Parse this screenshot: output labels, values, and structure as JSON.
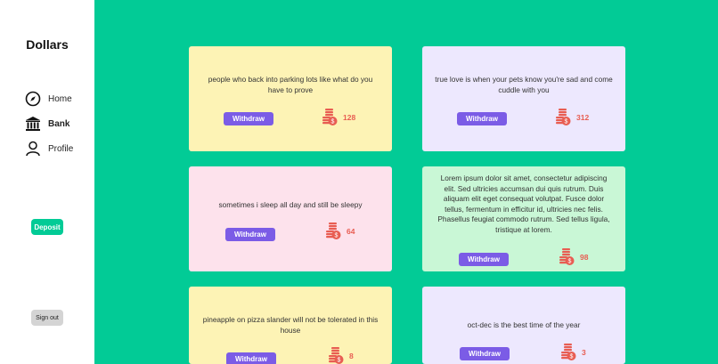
{
  "app": {
    "title": "Dollars"
  },
  "nav": [
    {
      "label": "Home",
      "icon": "compass-icon"
    },
    {
      "label": "Bank",
      "icon": "bank-icon",
      "active": true
    },
    {
      "label": "Profile",
      "icon": "user-icon"
    }
  ],
  "actions": {
    "deposit_label": "Deposit",
    "signout_label": "Sign out"
  },
  "cards": [
    {
      "text": "people who back into parking lots like what do you have to prove",
      "button": "Withdraw",
      "count": "128",
      "color": "#fdf3b5"
    },
    {
      "text": "true love is when your pets know you're sad and come cuddle with you",
      "button": "Withdraw",
      "count": "312",
      "color": "#ede8fe"
    },
    {
      "text": "sometimes i sleep all day and still be sleepy",
      "button": "Withdraw",
      "count": "64",
      "color": "#fde2ec"
    },
    {
      "text": "Lorem ipsum dolor sit amet, consectetur adipiscing elit. Sed ultricies accumsan dui quis rutrum. Duis aliquam elit eget consequat volutpat. Fusce dolor tellus, fermentum in efficitur id, ultricies nec felis. Phasellus feugiat commodo rutrum. Sed tellus ligula, tristique at lorem.",
      "button": "Withdraw",
      "count": "98",
      "color": "#c9f7d6"
    },
    {
      "text": "pineapple on pizza slander will not be tolerated in this house",
      "button": "Withdraw",
      "count": "8",
      "color": "#fdf3b5"
    },
    {
      "text": "oct-dec is the best time of the year",
      "button": "Withdraw",
      "count": "3",
      "color": "#ede8fe"
    }
  ],
  "colors": {
    "background": "#02cb96",
    "accent": "#7b5ce6",
    "coin": "#e85d52"
  }
}
